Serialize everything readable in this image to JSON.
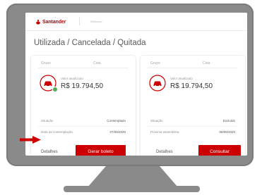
{
  "colors": {
    "brand": "#cc0000",
    "monitor": "#8a8a8a",
    "badge_ok": "#4caf50",
    "arrow": "#cc0000"
  },
  "header": {
    "logo_text": "Santander",
    "user_text": "Welcome"
  },
  "page": {
    "title": "Utilizada / Cancelada / Quitada"
  },
  "cards": [
    {
      "col_group": "Grupo",
      "col_quota": "Cota",
      "icon": "car-icon",
      "status_badge": "check-icon",
      "value_label": "Valor atualizado",
      "value": "R$ 19.794,50",
      "rows": [
        {
          "label": "Situação",
          "value": "Contemplado"
        },
        {
          "label": "Data da contemplação",
          "value": "07/05/2020"
        }
      ],
      "link_label": "Detalhes",
      "button_label": "Gerar boleto"
    },
    {
      "col_group": "Grupo",
      "col_quota": "Cota",
      "icon": "car-icon",
      "value_label": "Valor atualizado",
      "value": "R$ 19.794,50",
      "rows": [
        {
          "label": "Situação",
          "value": "Excluído"
        },
        {
          "label": "Próxima assembleia",
          "value": "06/08/2020"
        }
      ],
      "link_label": "Detalhes",
      "button_label": "Consultar"
    }
  ]
}
